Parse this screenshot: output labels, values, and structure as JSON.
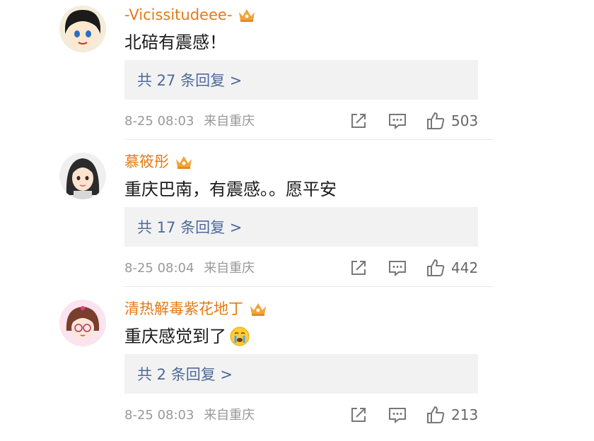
{
  "comments": [
    {
      "username": "-Vicissitudeee-",
      "content": "北碚有震感！",
      "emoji": "",
      "replies_label": "共 27 条回复 >",
      "time": "8-25 08:03",
      "location": "来自重庆",
      "likes": "503"
    },
    {
      "username": "慕筱彤",
      "content": "重庆巴南，有震感。。愿平安",
      "emoji": "",
      "replies_label": "共 17 条回复 >",
      "time": "8-25 08:04",
      "location": "来自重庆",
      "likes": "442"
    },
    {
      "username": "清热解毒紫花地丁",
      "content": "重庆感觉到了",
      "emoji": "crying-face-emoji",
      "replies_label": "共 2 条回复 >",
      "time": "8-25 08:03",
      "location": "来自重庆",
      "likes": "213"
    }
  ],
  "colors": {
    "username": "#e57a16",
    "reply_link": "#4e6a9b",
    "reply_box_bg": "#f2f2f2",
    "meta_text": "#999999",
    "crown": "#f0a437"
  },
  "icons": {
    "crown": "vip-crown-icon",
    "share": "share-icon",
    "reply": "comment-icon",
    "like": "thumbs-up-icon"
  }
}
